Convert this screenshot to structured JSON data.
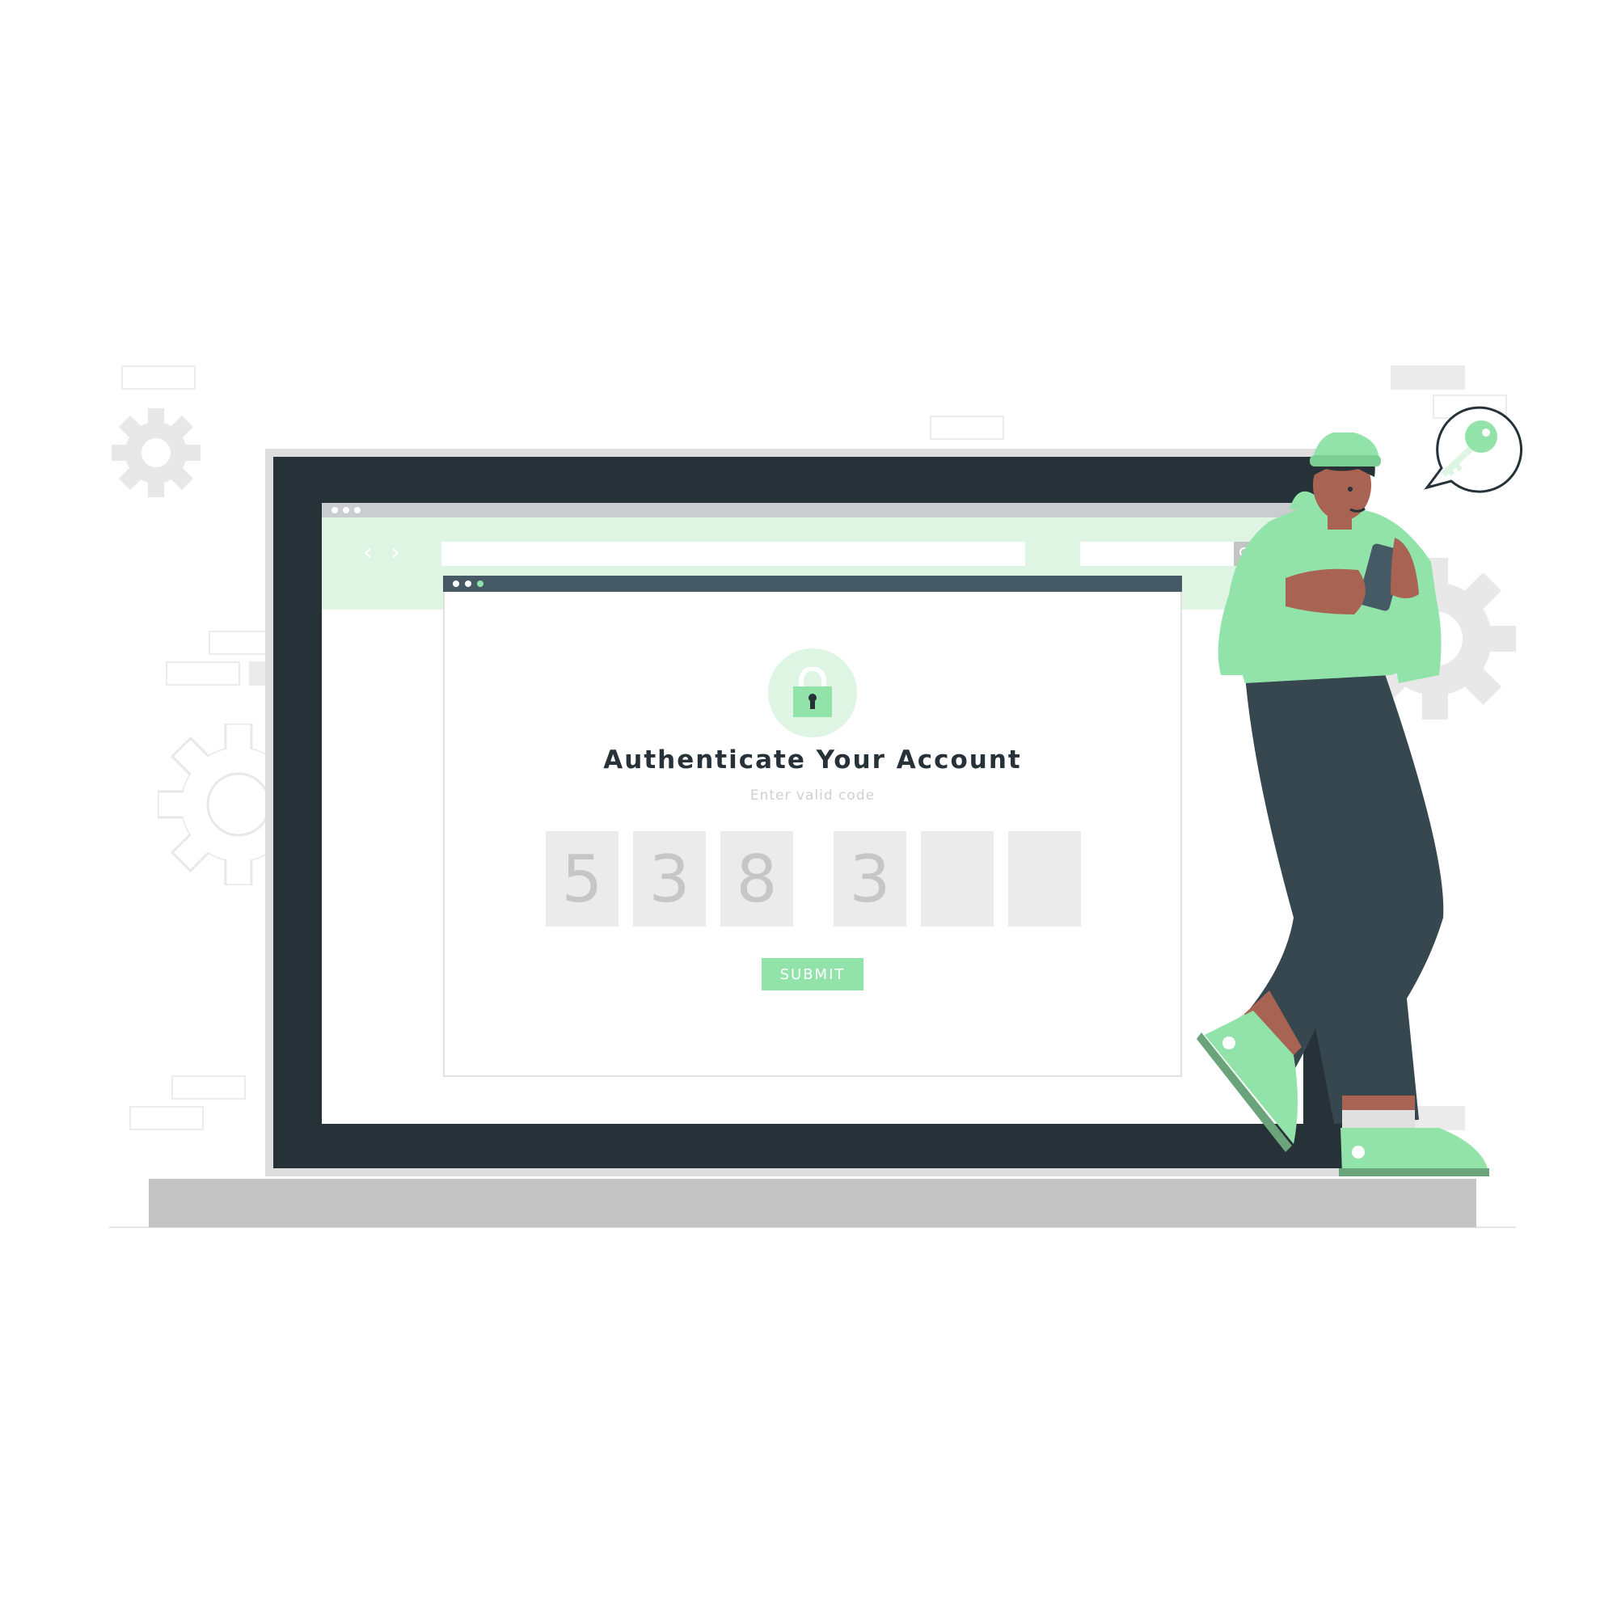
{
  "colors": {
    "accent": "#92e3a9",
    "accent_light": "#dff5e3",
    "dark": "#263238",
    "dialog_titlebar": "#455a64",
    "code_box": "#ebebeb",
    "code_digit": "#c6c6c6"
  },
  "browser": {
    "back_icon": "chevron-left-icon",
    "forward_icon": "chevron-right-icon",
    "back_glyph": "‹",
    "forward_glyph": "›",
    "address_value": "",
    "search_value": "",
    "search_icon": "search-icon"
  },
  "dialog": {
    "lock_icon": "lock-icon",
    "title": "Authenticate Your Account",
    "subtitle": "Enter valid code",
    "code_digits": [
      "5",
      "3",
      "8",
      "3",
      "",
      ""
    ],
    "submit_label": "SUBMIT"
  },
  "speech_bubble": {
    "icon": "key-icon"
  }
}
